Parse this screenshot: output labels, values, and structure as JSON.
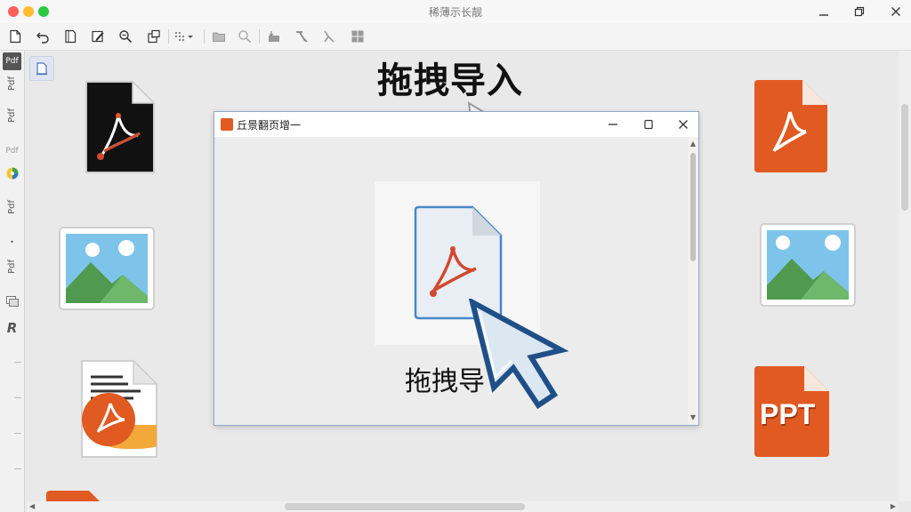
{
  "window": {
    "title": "稀薄示长靓",
    "controls": [
      "minimize-icon",
      "maximize-icon",
      "close-icon"
    ]
  },
  "toolbar": {
    "icons": [
      "new-document-icon",
      "undo-icon",
      "page-icon",
      "edit-icon",
      "zoom-edit-icon",
      "export-icon",
      "grid-dropdown-icon",
      "folder-icon",
      "search-icon",
      "import-icon",
      "tool-a-icon",
      "tool-b-icon",
      "windows-icon"
    ]
  },
  "side_strip": {
    "items": [
      "Pdf",
      "Pdf",
      "Pdf",
      "Pdf",
      "Pdf",
      "Pdf"
    ]
  },
  "headline": "拖拽导入",
  "dialog": {
    "title": "丘景翻页增一",
    "drop_label": "拖拽导"
  },
  "desktop_icons": [
    "pdf-file-icon-dark",
    "image-file-icon",
    "pdf-document-icon",
    "pdf-file-icon-orange",
    "image-file-icon-right",
    "ppt-file-icon"
  ],
  "ppt_label": "PPT",
  "colors": {
    "accent_orange": "#e05a22",
    "pdf_red": "#d04a2f",
    "file_blue": "#4a86c8",
    "sky": "#7ec4ea",
    "grass": "#4f9a4e"
  }
}
